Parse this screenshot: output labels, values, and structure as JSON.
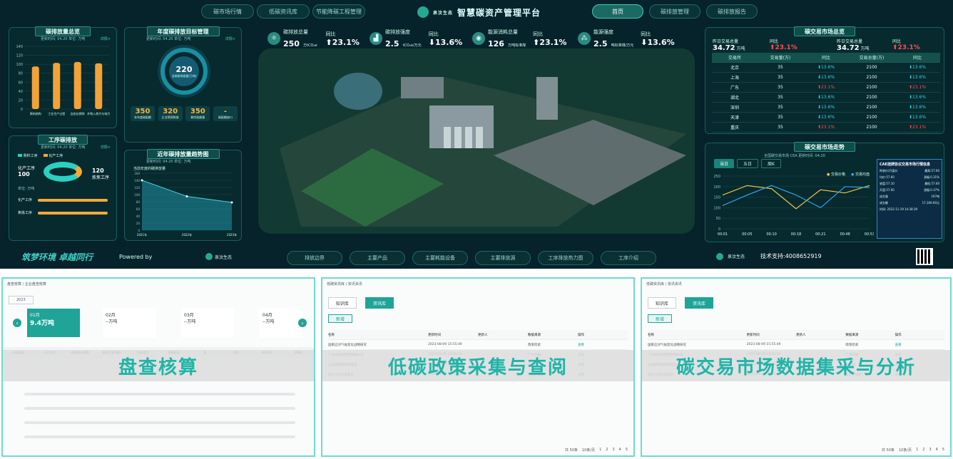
{
  "header": {
    "title": "智慧碳资产管理平台",
    "logo_text": "泉汶生态",
    "left_tabs": [
      "碳市场行情",
      "低碳资讯库",
      "节能降碳工程管理"
    ],
    "right_tabs": [
      "首页",
      "碳排放管理",
      "碳排放报告"
    ]
  },
  "kpis": [
    {
      "label": "碳排放总量",
      "value": "250",
      "unit": "万tCO₂e",
      "cmp_label": "同比",
      "cmp": "23.1%",
      "dir": "up"
    },
    {
      "label": "碳排放强度",
      "value": "2.5",
      "unit": "tCO₂e/万元",
      "cmp_label": "同比",
      "cmp": "13.6%",
      "dir": "down"
    },
    {
      "label": "能源消耗总量",
      "value": "126",
      "unit": "万吨标准煤",
      "cmp_label": "同比",
      "cmp": "23.1%",
      "dir": "up"
    },
    {
      "label": "能源强度",
      "value": "2.5",
      "unit": "吨标准煤/万元",
      "cmp_label": "同比",
      "cmp": "13.6%",
      "dir": "down"
    }
  ],
  "panels": {
    "emission_overview": {
      "title": "碳排放量总览",
      "meta": "更新时间: 04.20  单位: 万吨",
      "more": "详情>"
    },
    "annual_target": {
      "title": "年度碳排放目标管理",
      "meta": "更新时间: 04.20  单位: 万吨",
      "more": "详情>",
      "center_value": "220",
      "center_label": "当前碳排放量(万吨)",
      "stats": [
        {
          "v": "350",
          "l": "本年度碳配额"
        },
        {
          "v": "320",
          "l": "企业预测排放"
        },
        {
          "v": "350",
          "l": "剩余配额量"
        },
        {
          "v": "-",
          "l": "碳配额缺口"
        }
      ]
    },
    "process": {
      "title": "工序碳排放",
      "meta": "更新时间: 04.20  单位: 万吨",
      "more": "详情>",
      "legend": [
        "熟料工序",
        "化产工序"
      ],
      "left_label": "化产工序",
      "left_value": "100",
      "right_label": "炼焦工序",
      "right_value": "120",
      "unit": "单位: 万吨",
      "bars": [
        "化产工序",
        "焦炼工序"
      ]
    },
    "trend": {
      "title": "近年碳排放量趋势图",
      "meta": "更新时间: 04.20  单位: 万吨",
      "legend": "当前年度的碳排放量"
    },
    "market": {
      "title": "碳交易市场总览",
      "yesterday_label": "昨日交易总量",
      "yesterday_value": "34.72",
      "yesterday_unit": "万吨",
      "cmp_label": "同比",
      "cmp": "23.1%",
      "headers": [
        "交易所",
        "交易量(万)",
        "同比",
        "交易总量(万)",
        "同比"
      ],
      "rows": [
        [
          "北京",
          "35",
          "13.6%",
          "2100",
          "13.6%"
        ],
        [
          "上海",
          "35",
          "13.6%",
          "2100",
          "13.6%"
        ],
        [
          "广东",
          "35",
          "23.1%",
          "2100",
          "23.1%"
        ],
        [
          "湖北",
          "35",
          "13.6%",
          "2100",
          "13.6%"
        ],
        [
          "深圳",
          "35",
          "13.6%",
          "2100",
          "13.6%"
        ],
        [
          "天津",
          "35",
          "13.6%",
          "2100",
          "13.6%"
        ],
        [
          "重庆",
          "35",
          "23.1%",
          "2100",
          "23.1%"
        ]
      ],
      "row_dirs": [
        [
          "down",
          "down"
        ],
        [
          "down",
          "down"
        ],
        [
          "up",
          "up"
        ],
        [
          "down",
          "down"
        ],
        [
          "down",
          "down"
        ],
        [
          "down",
          "down"
        ],
        [
          "up",
          "up"
        ]
      ]
    },
    "market_trend": {
      "title": "碳交易市场走势",
      "meta": "全国碳交易市场  CEA  更新时间: 04.20",
      "ranges": [
        "当日",
        "五日",
        "周K"
      ],
      "legend": [
        "交易价格",
        "交易均值"
      ],
      "info_title": "CAE挂牌协议交易市场行情信息",
      "info_rows": [
        [
          "昨收价/开盘价",
          "最高:57.60"
        ],
        [
          "均价:57.60",
          "涨幅:0.31%"
        ],
        [
          "收盘:57.10",
          "最低:57.60"
        ],
        [
          "开盘:57.60",
          "涨幅:0.37%"
        ],
        [
          "成交量",
          "197吨"
        ],
        [
          "成交额",
          "17,166.60元"
        ]
      ],
      "info_time": "时间: 2022-11-19 14:38:39"
    }
  },
  "chart_data": [
    {
      "type": "bar",
      "title": "碳排放量总览",
      "categories": [
        "原料结构",
        "工业生产过程",
        "自由长期排",
        "外购入热力与电力"
      ],
      "values": [
        95,
        103,
        105,
        102
      ],
      "ylim": [
        0,
        140
      ],
      "yticks": [
        0,
        20,
        40,
        60,
        80,
        100,
        120,
        140
      ]
    },
    {
      "type": "area",
      "title": "近年碳排放量趋势图",
      "categories": [
        "2021年",
        "2022年",
        "2023年"
      ],
      "values": [
        140,
        95,
        78
      ],
      "ylim": [
        0,
        160
      ],
      "yticks": [
        0,
        20,
        40,
        60,
        80,
        100,
        120,
        140,
        160
      ]
    },
    {
      "type": "line",
      "title": "碳交易市场走势",
      "categories": [
        "00:01",
        "00:05",
        "00:10",
        "00:18",
        "00:21",
        "00:48",
        "00:53"
      ],
      "series": [
        {
          "name": "交易价格",
          "values": [
            160,
            205,
            190,
            95,
            185,
            170,
            205
          ]
        },
        {
          "name": "交易均值",
          "values": [
            110,
            160,
            205,
            160,
            100,
            200,
            195
          ]
        }
      ],
      "ylim": [
        0,
        250
      ],
      "yticks": [
        0,
        50,
        100,
        150,
        200,
        250
      ]
    }
  ],
  "bottom_tabs": [
    "排放边界",
    "主要产品",
    "主要耗能设备",
    "主要排放源",
    "工序排放热力图",
    "工序介绍"
  ],
  "footer": {
    "slogan": "筑梦环境  卓越同行",
    "powered": "Powered by",
    "logo_text": "泉汶生态",
    "support": "技术支持:4008652919"
  },
  "cards": [
    {
      "label": "盘查核算",
      "breadcrumb": "盘查核算 / 企业盘查核算",
      "year": "2023",
      "months": [
        "01月",
        "02月",
        "03月",
        "04月"
      ],
      "month_values": [
        "9.4万吨",
        "--万吨",
        "--万吨",
        "--万吨"
      ],
      "headers": [
        "核算层级",
        "企业名称",
        "排放源与核算汇",
        "燃料/设备/燃料",
        "排放类型",
        "数据来源",
        "值",
        "单位",
        "排放证明",
        "测算值"
      ]
    },
    {
      "label": "低碳政策采集与查阅",
      "breadcrumb": "低碳资讯库 / 资讯资讯",
      "tabs": [
        "知识库",
        "资讯库"
      ],
      "add": "新增",
      "headers": [
        "名称",
        "更新时间",
        "更新人",
        "数据来源",
        "操作"
      ],
      "rows": [
        [
          "国家应对气候变化战略研究",
          "2023-08-09 15:55:49",
          "",
          "政策检索",
          "查看"
        ],
        [
          "广州出台碳普惠管理办法",
          "2023-08-09 15:55:50",
          "",
          "广州日报",
          "查看"
        ],
        [
          "企业碳管理体系建设",
          "2023-08-09 15:55:50",
          "",
          "人民网",
          "查看"
        ],
        [
          "关于公开征求意见",
          "2023-08-09 15:55:51",
          "",
          "生态环境部",
          "查看"
        ]
      ],
      "pagination": [
        "共 50条",
        "10条/页",
        "1",
        "2",
        "3",
        "4",
        "5"
      ]
    },
    {
      "label": "碳交易市场数据集采与分析",
      "breadcrumb": "低碳资讯库 / 资讯资讯",
      "tabs": [
        "知识库",
        "资讯库"
      ],
      "add": "新增",
      "headers": [
        "名称",
        "更新时间",
        "更新人",
        "数据来源",
        "操作"
      ],
      "rows": [
        [
          "国家应对气候变化战略研究",
          "2023-08-09 15:55:49",
          "",
          "政策检索",
          "查看"
        ],
        [
          "广州出台碳普惠管理办法",
          "2023-08-09 15:55:50",
          "",
          "广州日报",
          "查看"
        ],
        [
          "企业碳管理体系建设",
          "2023-08-09 15:55:50",
          "",
          "人民网",
          "查看"
        ],
        [
          "关于公开征求意见",
          "2023-08-09 15:55:51",
          "",
          "生态环境部",
          "查看"
        ]
      ],
      "pagination": [
        "共 50条",
        "10条/页",
        "1",
        "2",
        "3",
        "4",
        "5"
      ]
    }
  ]
}
